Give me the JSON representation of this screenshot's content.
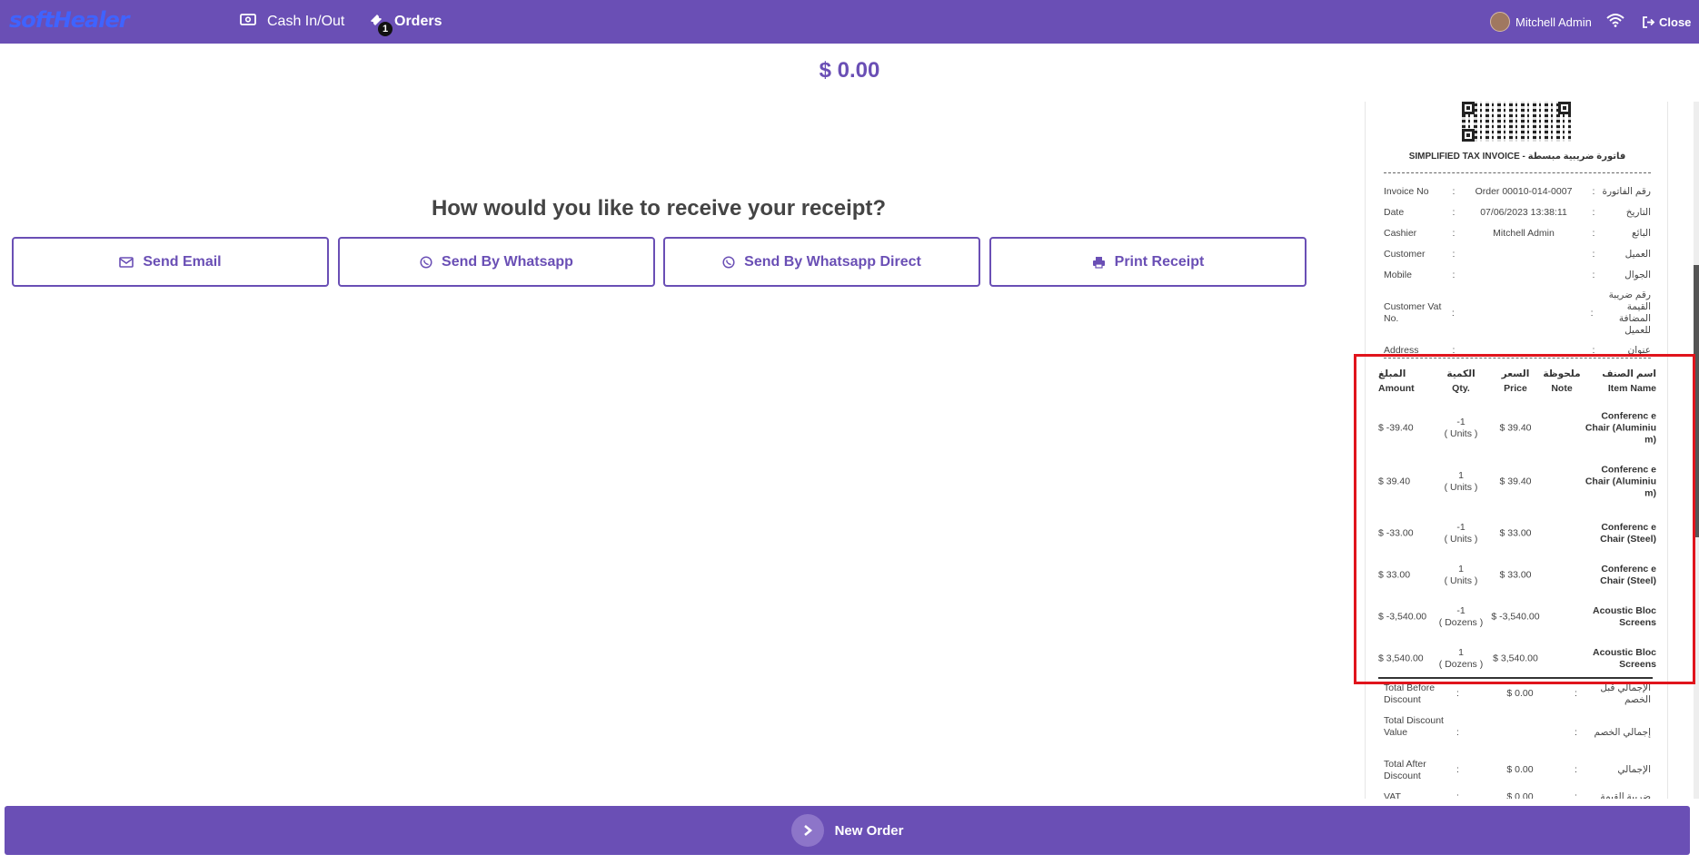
{
  "topbar": {
    "logo": "softHealer",
    "cash_label": "Cash In/Out",
    "orders_label": "Orders",
    "orders_badge": "1",
    "user_name": "Mitchell Admin",
    "close_label": "Close"
  },
  "main": {
    "amount": "$ 0.00",
    "question": "How would you like to receive your receipt?",
    "buttons": {
      "email": "Send Email",
      "whatsapp": "Send By Whatsapp",
      "whatsapp_direct": "Send By Whatsapp Direct",
      "print": "Print Receipt"
    }
  },
  "receipt": {
    "title": "SIMPLIFIED TAX INVOICE - فاتورة ضريبية مبسطة",
    "info": [
      {
        "k": "Invoice No",
        "v": "Order 00010-014-0007",
        "ar": "رقم الفاتورة"
      },
      {
        "k": "Date",
        "v": "07/06/2023 13:38:11",
        "ar": "التاريخ"
      },
      {
        "k": "Cashier",
        "v": "Mitchell Admin",
        "ar": "البائع"
      },
      {
        "k": "Customer",
        "v": "",
        "ar": "العميل"
      },
      {
        "k": "Mobile",
        "v": "",
        "ar": "الجوال"
      },
      {
        "k": "Customer Vat No.",
        "v": "",
        "ar": "رقم ضريبة القيمة المضافة للعميل"
      },
      {
        "k": "Address",
        "v": "",
        "ar": "عنوان"
      }
    ],
    "headers": {
      "amount_ar": "المبلغ",
      "amount": "Amount",
      "qty_ar": "الكمية",
      "qty": "Qty.",
      "price_ar": "السعر",
      "price": "Price",
      "note_ar": "ملحوظة",
      "note": "Note",
      "name_ar": "اسم الصنف",
      "name": "Item Name"
    },
    "items": [
      {
        "amount": "$ -39.40",
        "qty": "-1",
        "uom": "( Units )",
        "price": "$ 39.40",
        "name": "Conferenc e Chair (Aluminiu m)"
      },
      {
        "amount": "$ 39.40",
        "qty": "1",
        "uom": "( Units )",
        "price": "$ 39.40",
        "name": "Conferenc e Chair (Aluminiu m)"
      },
      {
        "amount": "$ -33.00",
        "qty": "-1",
        "uom": "( Units )",
        "price": "$ 33.00",
        "name": "Conferenc e Chair (Steel)"
      },
      {
        "amount": "$ 33.00",
        "qty": "1",
        "uom": "( Units )",
        "price": "$ 33.00",
        "name": "Conferenc e Chair (Steel)"
      },
      {
        "amount": "$ -3,540.00",
        "qty": "-1",
        "uom": "( Dozens )",
        "price": "$ -3,540.00",
        "name": "Acoustic Bloc Screens"
      },
      {
        "amount": "$ 3,540.00",
        "qty": "1",
        "uom": "( Dozens )",
        "price": "$ 3,540.00",
        "name": "Acoustic Bloc Screens"
      }
    ],
    "totals": [
      {
        "k": "Total Before Discount",
        "v": "$ 0.00",
        "ar": "الإجمالي قبل الخصم"
      },
      {
        "k": "Total Discount Value",
        "v": "",
        "ar": "إجمالي الخصم"
      },
      {
        "k": "Total After Discount",
        "v": "$ 0.00",
        "ar": "الإجمالي"
      },
      {
        "k": "VAT",
        "v": "$ 0.00",
        "ar": "ضريبة القيمة"
      }
    ]
  },
  "bottom": {
    "new_order": "New Order"
  },
  "colors": {
    "brand": "#6a4fb5",
    "highlight": "#e0141c"
  }
}
